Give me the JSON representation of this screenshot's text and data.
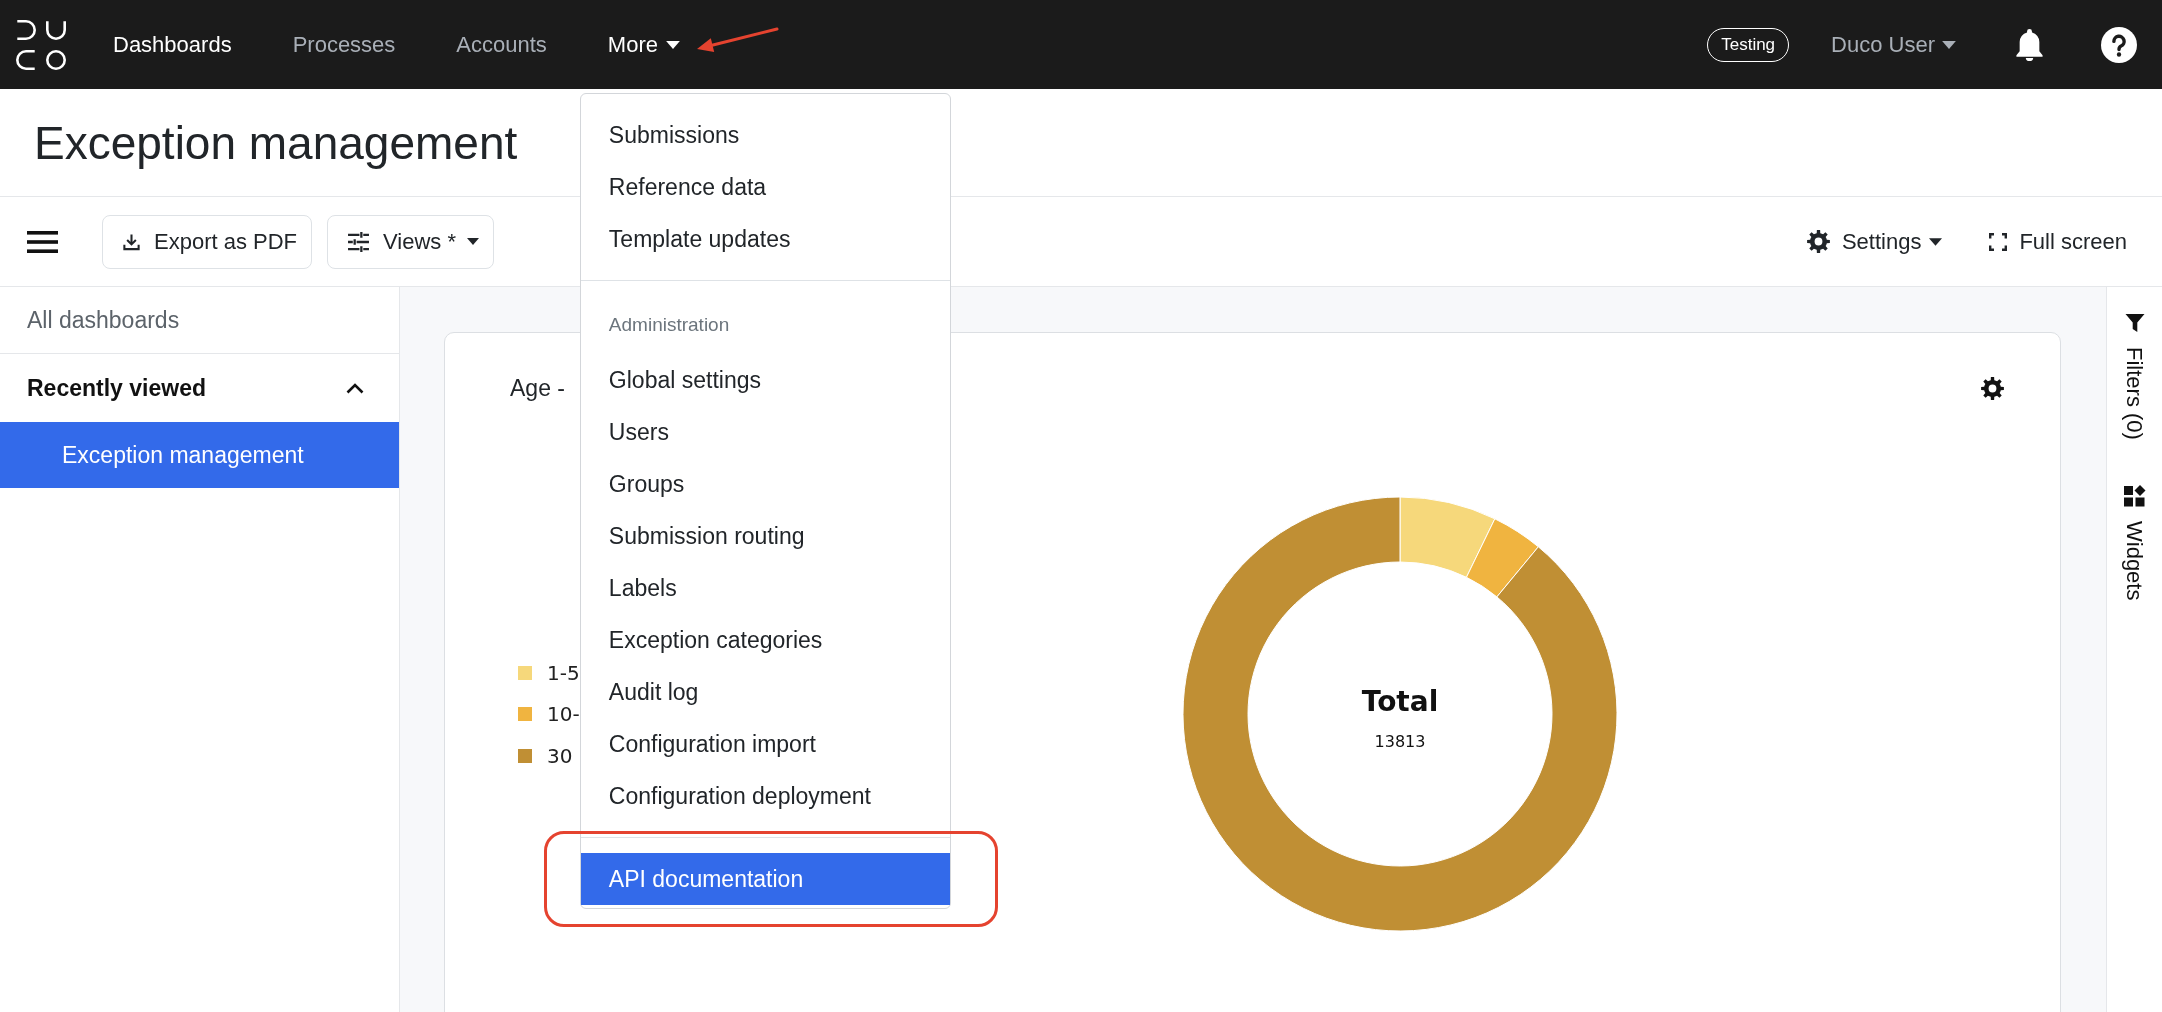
{
  "navbar": {
    "items": [
      {
        "label": "Dashboards",
        "kind": "link",
        "selected": true,
        "callout": false
      },
      {
        "label": "Processes",
        "kind": "link",
        "selected": false,
        "callout": false
      },
      {
        "label": "Accounts",
        "kind": "link",
        "selected": false,
        "callout": false
      },
      {
        "label": "More",
        "kind": "dropdown",
        "expanded": true,
        "callout": true,
        "menu": [
          {
            "items": [
              {
                "label": "Submissions",
                "selected": false,
                "callout": false
              },
              {
                "label": "Reference data",
                "selected": false,
                "callout": false
              },
              {
                "label": "Template updates",
                "selected": false,
                "callout": false
              }
            ]
          },
          {
            "header": "Administration",
            "items": [
              {
                "label": "Global settings",
                "selected": false,
                "callout": false
              },
              {
                "label": "Users",
                "selected": false,
                "callout": false
              },
              {
                "label": "Groups",
                "selected": false,
                "callout": false
              },
              {
                "label": "Submission routing",
                "selected": false,
                "callout": false
              },
              {
                "label": "Labels",
                "selected": false,
                "callout": false
              },
              {
                "label": "Exception categories",
                "selected": false,
                "callout": false
              },
              {
                "label": "Audit log",
                "selected": false,
                "callout": false
              },
              {
                "label": "Configuration import",
                "selected": false,
                "callout": false
              },
              {
                "label": "Configuration deployment",
                "selected": false,
                "callout": false
              }
            ]
          },
          {
            "items": [
              {
                "label": "API documentation",
                "selected": true,
                "callout": true
              }
            ]
          }
        ]
      }
    ],
    "badge": "Testing",
    "user": {
      "label": "Duco User"
    }
  },
  "page_title": "Exception management",
  "toolbar": {
    "left": [
      {
        "label": "Export as PDF",
        "dropdown": false
      },
      {
        "label": "Views *",
        "dropdown": true
      }
    ],
    "right": [
      {
        "label": "Settings",
        "dropdown": true
      },
      {
        "label": "Full screen",
        "dropdown": false
      }
    ]
  },
  "sidebar": {
    "items": [
      {
        "label": "All dashboards",
        "kind": "link",
        "selected": false
      },
      {
        "label": "Recently viewed",
        "kind": "section",
        "expanded": true,
        "children": [
          {
            "label": "Exception management",
            "selected": true
          }
        ]
      }
    ]
  },
  "widget": {
    "title": "Age -",
    "legend": [
      {
        "label": "1-5",
        "color": "#f6d87b"
      },
      {
        "label": "10-",
        "color": "#f0b440"
      },
      {
        "label": "30",
        "color": "#c08f34"
      }
    ],
    "total_label": "Total",
    "total_value": "13813"
  },
  "right_rail": {
    "items": [
      {
        "label": "Filters (0)"
      },
      {
        "label": "Widgets"
      }
    ]
  }
}
